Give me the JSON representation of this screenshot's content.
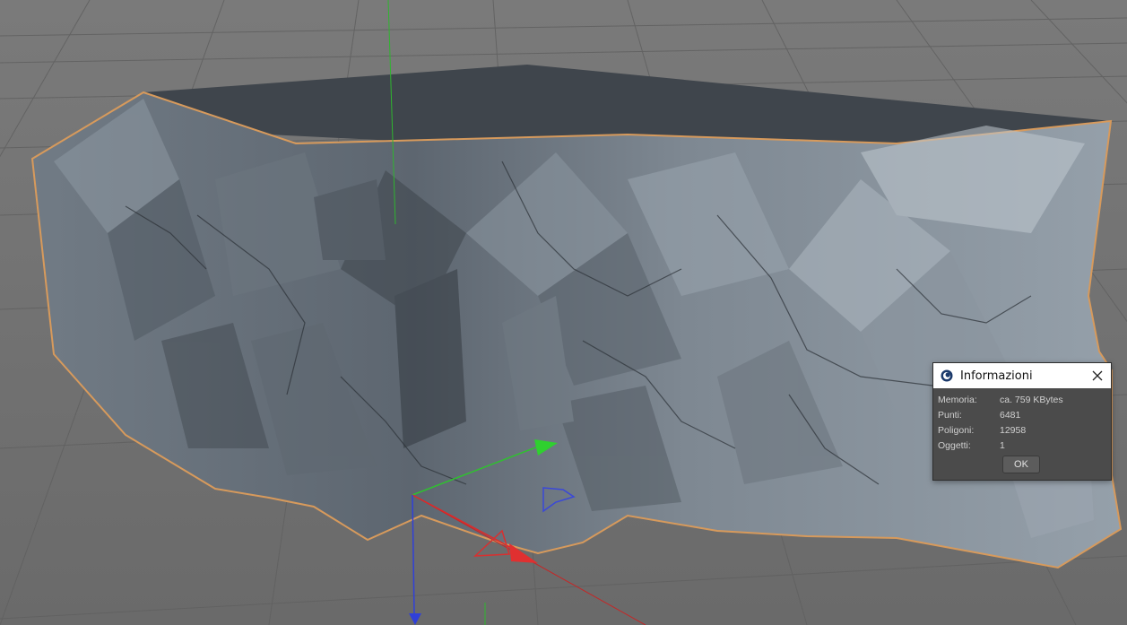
{
  "app": {
    "accent_color": "#e0a060",
    "viewport_background": "#6f6f6f"
  },
  "viewport": {
    "object": "rock-mesh",
    "axis_colors": {
      "x": "#e02020",
      "y": "#20c020",
      "z": "#2030d0"
    }
  },
  "dialog": {
    "title": "Informazioni",
    "app_icon": "cinema4d-logo-icon",
    "close_icon": "close-icon",
    "rows": [
      {
        "label": "Memoria:",
        "value": "ca. 759 KBytes"
      },
      {
        "label": "Punti:",
        "value": "6481"
      },
      {
        "label": "Poligoni:",
        "value": "12958"
      },
      {
        "label": "Oggetti:",
        "value": "1"
      }
    ],
    "ok_label": "OK"
  }
}
